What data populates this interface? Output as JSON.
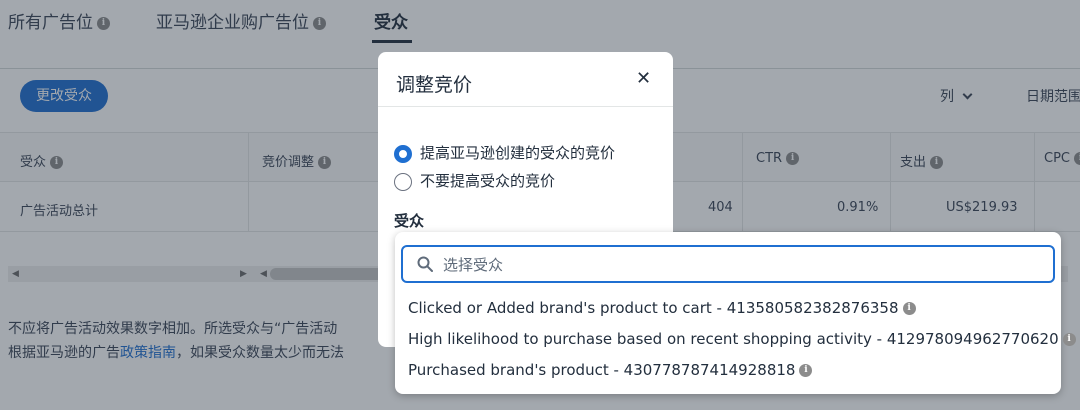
{
  "tabs": [
    {
      "label": "所有广告位"
    },
    {
      "label": "亚马逊企业购广告位"
    },
    {
      "label": "受众"
    }
  ],
  "toolbar": {
    "change_audience_label": "更改受众",
    "columns_label": "列",
    "date_range_label": "日期范围"
  },
  "table": {
    "headers": [
      "受众",
      "竞价调整",
      "CTR",
      "支出",
      "CPC"
    ],
    "summary_row": {
      "label": "广告活动总计",
      "clicks": "404",
      "ctr": "0.91%",
      "spend": "US$219.93"
    }
  },
  "notes": {
    "line1": "不应将广告活动效果数字相加。所选受众与“广告活动",
    "line2_prefix": "根据亚马逊的广告",
    "line2_link": "政策指南",
    "line2_suffix": "，如果受众数量太少而无法"
  },
  "modal": {
    "title": "调整竞价",
    "radio_options": [
      {
        "label": "提高亚马逊创建的受众的竞价",
        "checked": true
      },
      {
        "label": "不要提高受众的竞价",
        "checked": false
      }
    ],
    "audience_label": "受众"
  },
  "dropdown": {
    "search_placeholder": "选择受众",
    "options": [
      {
        "label": "Clicked or Added brand's product to cart - 413580582382876358"
      },
      {
        "label": "High likelihood to purchase based on recent shopping activity - 412978094962770620"
      },
      {
        "label": "Purchased brand's product - 430778787414928818"
      }
    ]
  },
  "colors": {
    "accent": "#1f6fd1",
    "text": "#232f3e"
  }
}
